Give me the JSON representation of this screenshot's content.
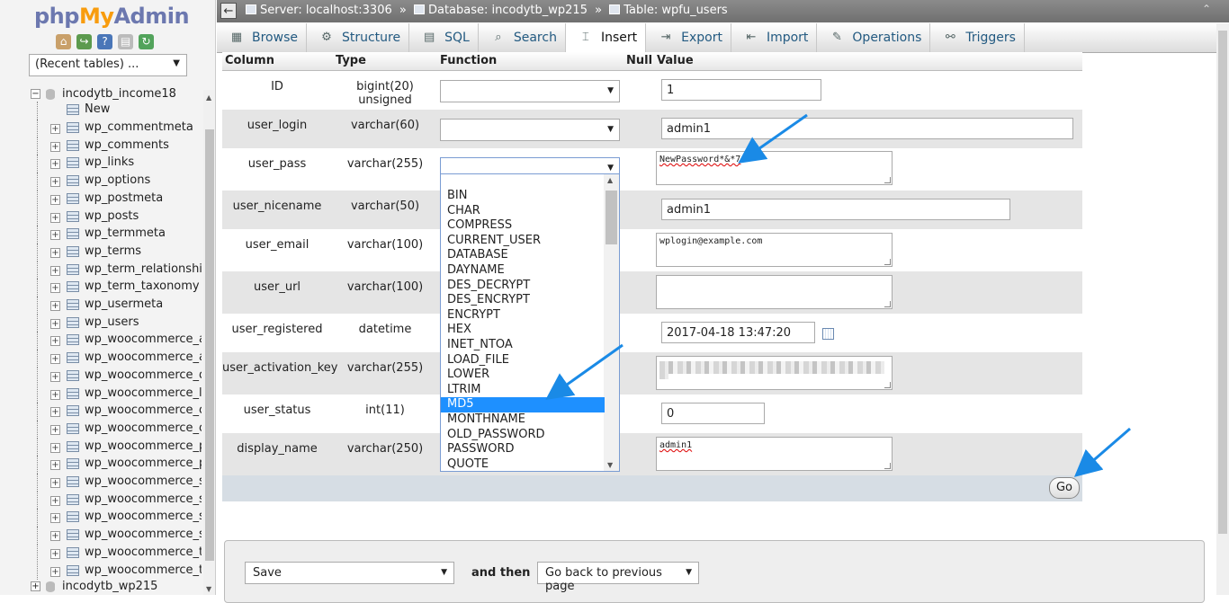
{
  "logo": {
    "php": "php",
    "my": "My",
    "admin": "Admin"
  },
  "left": {
    "recent_tables": "(Recent tables) ...",
    "db_top": "incodytb_income18",
    "new_label": "New",
    "tables": [
      "wp_commentmeta",
      "wp_comments",
      "wp_links",
      "wp_options",
      "wp_postmeta",
      "wp_posts",
      "wp_termmeta",
      "wp_terms",
      "wp_term_relationships",
      "wp_term_taxonomy",
      "wp_usermeta",
      "wp_users",
      "wp_woocommerce_api_keys",
      "wp_woocommerce_attribute_taxonomies",
      "wp_woocommerce_downloadable_product_permissions",
      "wp_woocommerce_log",
      "wp_woocommerce_order_itemmeta",
      "wp_woocommerce_order_items",
      "wp_woocommerce_payment_tokenmeta",
      "wp_woocommerce_payment_tokens",
      "wp_woocommerce_sessions",
      "wp_woocommerce_shipping_zone_locations",
      "wp_woocommerce_shipping_zone_methods",
      "wp_woocommerce_shipping_zones",
      "wp_woocommerce_tax_rate_locations",
      "wp_woocommerce_tax_rates"
    ],
    "db_bottom": "incodytb_wp215"
  },
  "breadcrumb": {
    "server": "Server: localhost:3306",
    "database": "Database: incodytb_wp215",
    "table": "Table: wpfu_users",
    "sep": "»"
  },
  "tabs": [
    {
      "label": "Browse",
      "icon": "browse-icon"
    },
    {
      "label": "Structure",
      "icon": "structure-icon"
    },
    {
      "label": "SQL",
      "icon": "sql-icon"
    },
    {
      "label": "Search",
      "icon": "search-icon"
    },
    {
      "label": "Insert",
      "icon": "insert-icon",
      "active": true
    },
    {
      "label": "Export",
      "icon": "export-icon"
    },
    {
      "label": "Import",
      "icon": "import-icon"
    },
    {
      "label": "Operations",
      "icon": "wrench-icon"
    },
    {
      "label": "Triggers",
      "icon": "triggers-icon"
    }
  ],
  "headers": {
    "column": "Column",
    "type": "Type",
    "function": "Function",
    "null": "Null",
    "value": "Value"
  },
  "rows": [
    {
      "column": "ID",
      "type": "bigint(20) unsigned",
      "value": "1"
    },
    {
      "column": "user_login",
      "type": "varchar(60)",
      "value": "admin1"
    },
    {
      "column": "user_pass",
      "type": "varchar(255)",
      "value": "NewPassword*&*7"
    },
    {
      "column": "user_nicename",
      "type": "varchar(50)",
      "value": "admin1"
    },
    {
      "column": "user_email",
      "type": "varchar(100)",
      "value": "wplogin@example.com"
    },
    {
      "column": "user_url",
      "type": "varchar(100)",
      "value": ""
    },
    {
      "column": "user_registered",
      "type": "datetime",
      "value": "2017-04-18 13:47:20"
    },
    {
      "column": "user_activation_key",
      "type": "varchar(255)",
      "value": ""
    },
    {
      "column": "user_status",
      "type": "int(11)",
      "value": "0"
    },
    {
      "column": "display_name",
      "type": "varchar(250)",
      "value": "admin1"
    }
  ],
  "function_options": [
    "BIN",
    "CHAR",
    "COMPRESS",
    "CURRENT_USER",
    "DATABASE",
    "DAYNAME",
    "DES_DECRYPT",
    "DES_ENCRYPT",
    "ENCRYPT",
    "HEX",
    "INET_NTOA",
    "LOAD_FILE",
    "LOWER",
    "LTRIM",
    "MD5",
    "MONTHNAME",
    "OLD_PASSWORD",
    "PASSWORD",
    "QUOTE"
  ],
  "selected_function": "MD5",
  "go_label": "Go",
  "footer": {
    "save": "Save",
    "and_then": "and then",
    "after": "Go back to previous page"
  },
  "colors": {
    "accent": "#1e90ff",
    "arrow": "#1a8ae6",
    "row_alt": "#e5e5e5"
  }
}
